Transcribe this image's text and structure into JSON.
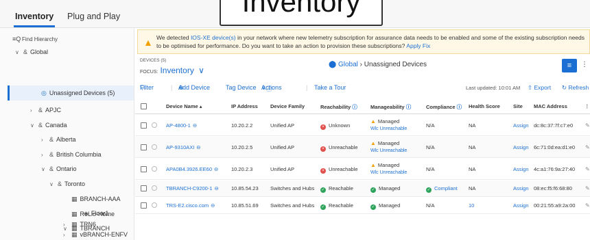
{
  "tabs": [
    {
      "label": "Inventory"
    },
    {
      "label": "Plug and Play"
    }
  ],
  "overlay_title": "Inventory",
  "sidebar": {
    "find_label": "Find Hierarchy",
    "tree": [
      {
        "label": "Global"
      },
      {
        "label": "Unassigned Devices (5)"
      },
      {
        "label": "APJC"
      },
      {
        "label": "Canada"
      },
      {
        "label": "Alberta"
      },
      {
        "label": "British Columbia"
      },
      {
        "label": "Ontario"
      },
      {
        "label": "Toronto"
      },
      {
        "label": "BRANCH-AAA"
      },
      {
        "label": "RoLlo-Home"
      },
      {
        "label": "TBRANCH"
      },
      {
        "label": "Floor1"
      },
      {
        "label": "TRN6"
      },
      {
        "label": "vBRANCH-ENFV"
      }
    ]
  },
  "banner": {
    "text_before": "We detected ",
    "link1": "IOS-XE device(s)",
    "text_after": " in your network where new telemetry subscription for assurance data needs to be enabled and some of the existing subscription needs to be optimised for performance. Do you want to take an action to provision these subscriptions? ",
    "link2": "Apply Fix"
  },
  "header": {
    "device_count": "DEVICES (5)",
    "focus_label": "FOCUS:",
    "focus_value": "Inventory",
    "crumb_location": "Global",
    "crumb_current": "Unassigned Devices"
  },
  "toolbar": {
    "filter": "Filter",
    "add_device": "Add Device",
    "tag_device": "Tag Device",
    "actions": "Actions",
    "take_tour": "Take a Tour",
    "last_updated": "Last updated: 10:01 AM",
    "export": "Export",
    "refresh": "Refresh"
  },
  "table": {
    "columns": [
      "Device Name",
      "IP Address",
      "Device Family",
      "Reachability",
      "Manageability",
      "Compliance",
      "Health Score",
      "Site",
      "MAC Address"
    ],
    "rows": [
      {
        "name": "AP-4800-1",
        "ip": "10.20.2.2",
        "family": "Unified AP",
        "reach": "Unknown",
        "reach_state": "down",
        "manage": "Managed",
        "manage_state": "warn",
        "manage_sub": "Wlc Unreachable",
        "compliance": "N/A",
        "compliance_state": "none",
        "health": "NA",
        "site": "Assign",
        "mac": "dc:8c:37:7f:c7:e0"
      },
      {
        "name": "AP-9310AXI",
        "ip": "10.20.2.5",
        "family": "Unified AP",
        "reach": "Unreachable",
        "reach_state": "down",
        "manage": "Managed",
        "manage_state": "warn",
        "manage_sub": "Wlc Unreachable",
        "compliance": "N/A",
        "compliance_state": "none",
        "health": "NA",
        "site": "Assign",
        "mac": "6c:71:0d:ea:d1:e0"
      },
      {
        "name": "APA0B4.3926.EE60",
        "ip": "10.20.2.3",
        "family": "Unified AP",
        "reach": "Unreachable",
        "reach_state": "down",
        "manage": "Managed",
        "manage_state": "warn",
        "manage_sub": "Wlc Unreachable",
        "compliance": "N/A",
        "compliance_state": "none",
        "health": "NA",
        "site": "Assign",
        "mac": "4c:a1:76:9a:27:40"
      },
      {
        "name": "TBRANCH-C9200-1",
        "ip": "10.85.54.23",
        "family": "Switches and Hubs",
        "reach": "Reachable",
        "reach_state": "up",
        "manage": "Managed",
        "manage_state": "ok",
        "manage_sub": "",
        "compliance": "Compliant",
        "compliance_state": "ok",
        "health": "NA",
        "site": "Assign",
        "mac": "08:ec:f5:f6:68:80"
      },
      {
        "name": "TRS-E2.cisco.com",
        "ip": "10.85.51.69",
        "family": "Switches and Hubs",
        "reach": "Reachable",
        "reach_state": "up",
        "manage": "Managed",
        "manage_state": "ok",
        "manage_sub": "",
        "compliance": "N/A",
        "compliance_state": "none",
        "health": "10",
        "site": "Assign",
        "mac": "00:21:55:a9:2a:00"
      }
    ]
  },
  "colors": {
    "accent": "#1b6fd2",
    "ok": "#2ea35b",
    "error": "#e1504a",
    "warning": "#f2a100"
  }
}
